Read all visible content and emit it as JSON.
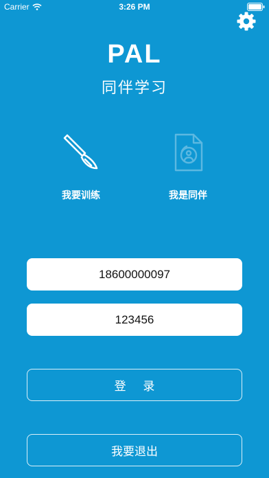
{
  "status_bar": {
    "carrier": "Carrier",
    "time": "3:26 PM"
  },
  "header": {
    "title": "PAL",
    "subtitle": "同伴学习"
  },
  "roles": [
    {
      "label": "我要训练",
      "icon": "scalpel-icon",
      "selected": true
    },
    {
      "label": "我是同伴",
      "icon": "partner-id-icon",
      "selected": false
    }
  ],
  "form": {
    "phone": "18600000097",
    "password": "123456"
  },
  "buttons": {
    "login": "登 录",
    "exit": "我要退出"
  },
  "colors": {
    "background": "#0e97d3",
    "field_background": "#ffffff",
    "text": "#ffffff"
  }
}
